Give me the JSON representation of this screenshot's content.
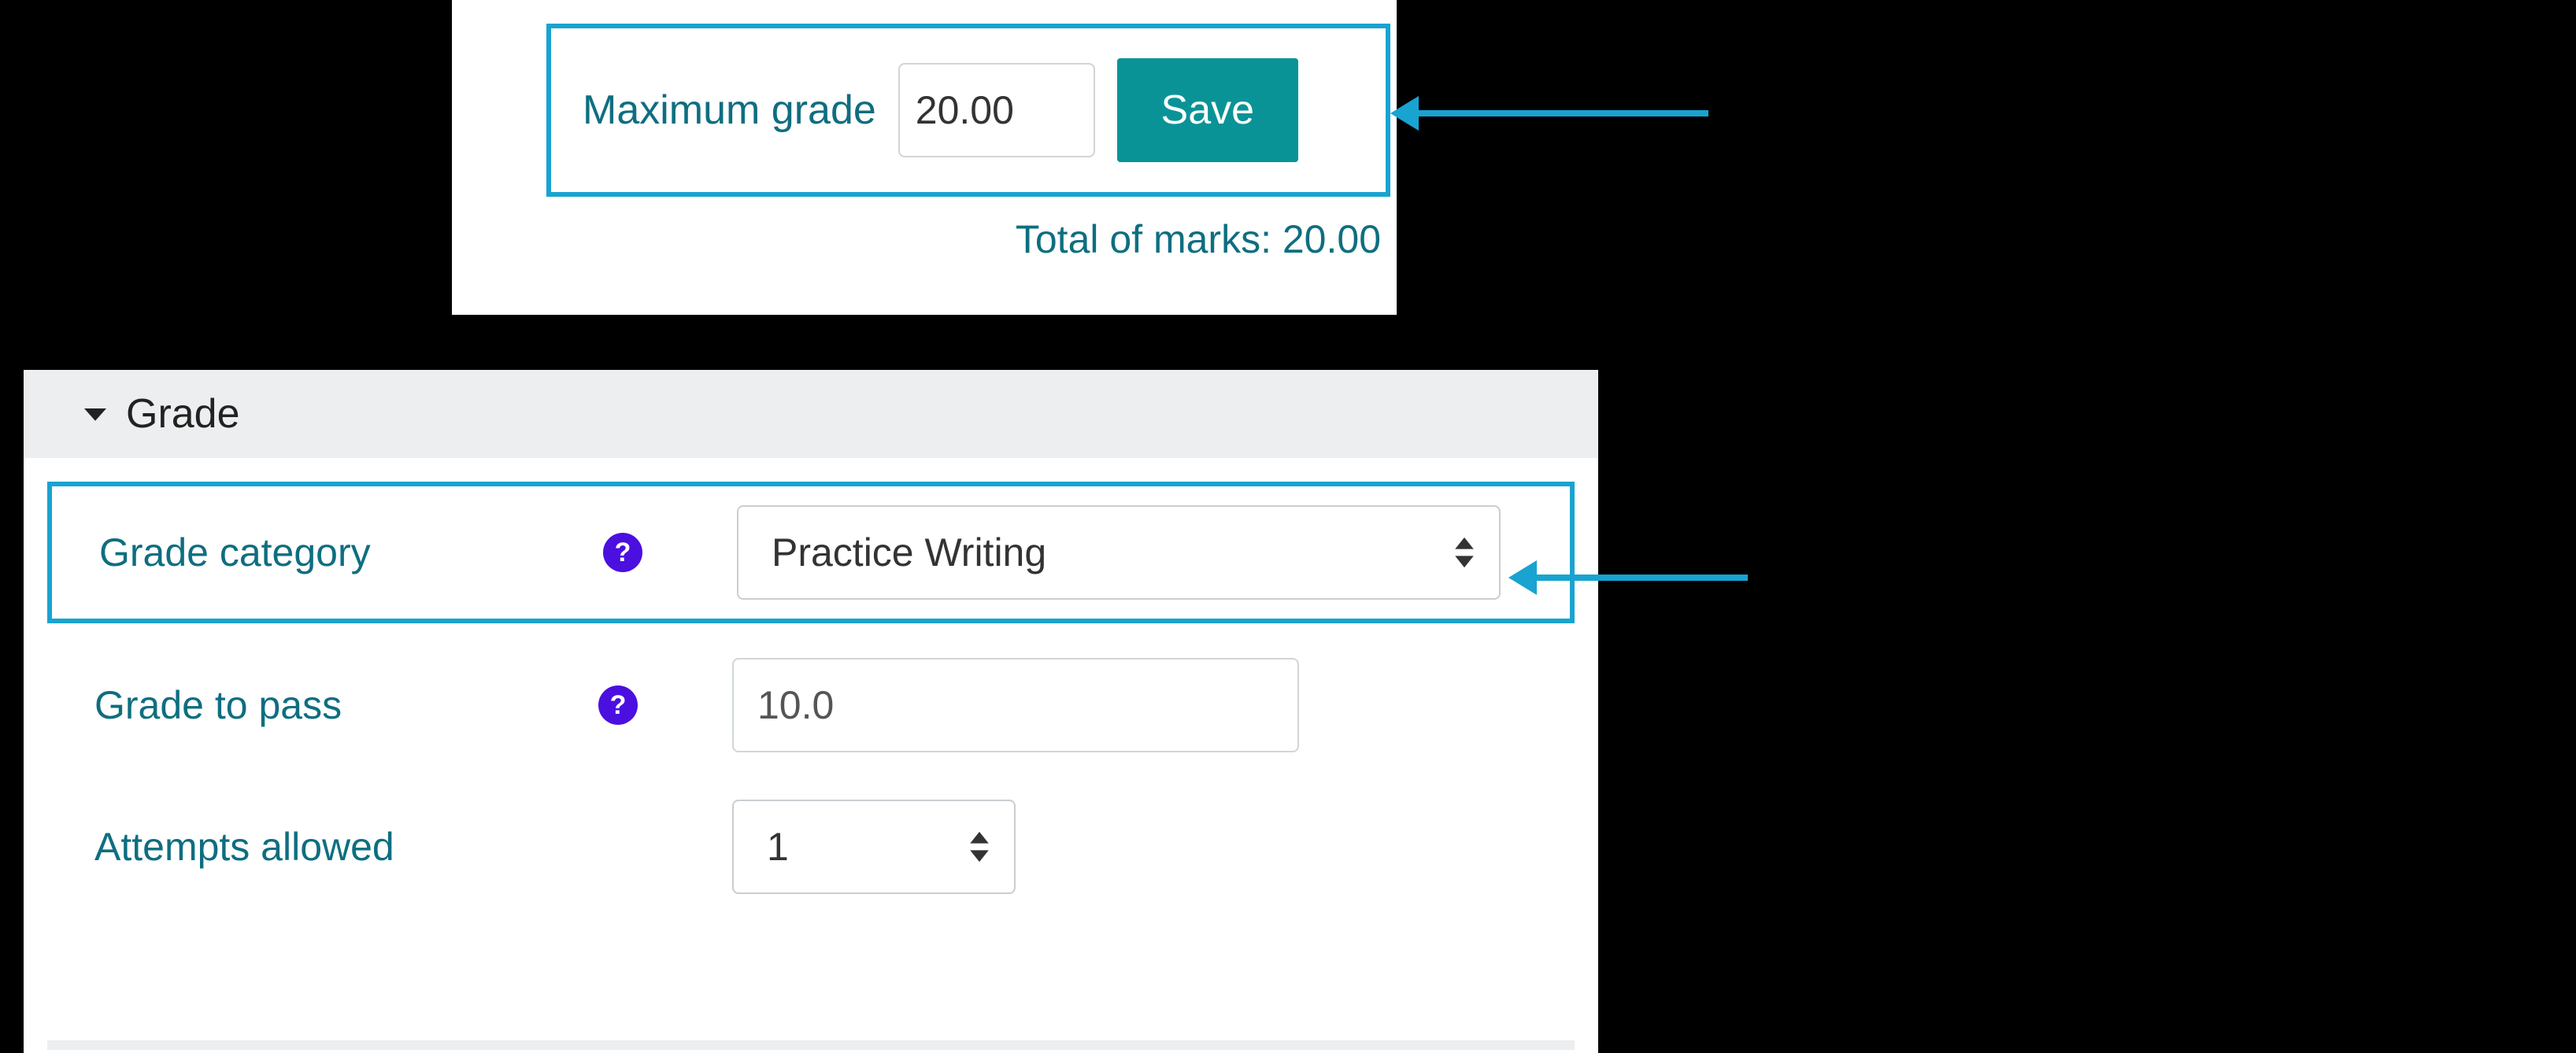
{
  "popover": {
    "maxGradeLabel": "Maximum grade",
    "maxGradeValue": "20.00",
    "saveLabel": "Save",
    "totalMarksLabel": "Total of marks: ",
    "totalMarksValue": "20.00"
  },
  "settings": {
    "sectionTitle": "Grade",
    "gradeCategory": {
      "label": "Grade category",
      "value": "Practice Writing"
    },
    "gradeToPass": {
      "label": "Grade to pass",
      "value": "10.0"
    },
    "attempts": {
      "label": "Attempts allowed",
      "value": "1"
    }
  },
  "icons": {
    "helpGlyph": "?"
  }
}
